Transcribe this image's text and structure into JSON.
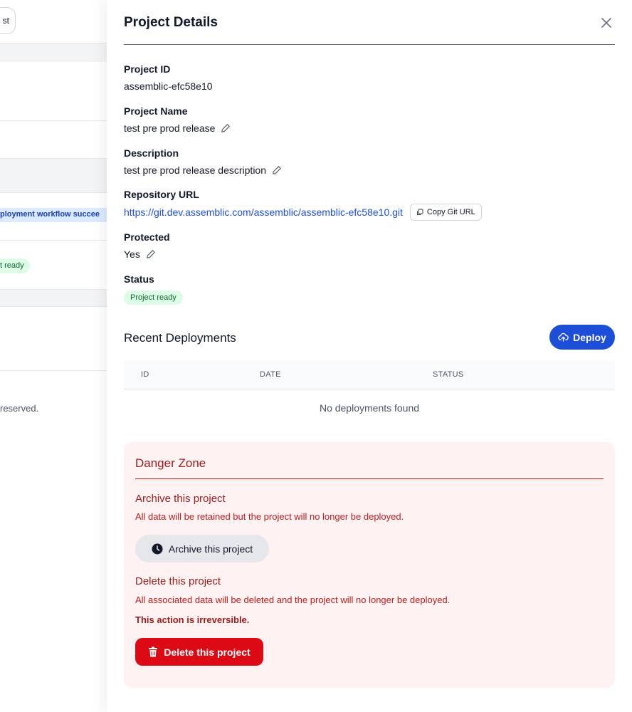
{
  "background": {
    "button_fragment": "st",
    "badge_blue_text": "ployment workflow succee",
    "badge_green_text": "t ready",
    "footer_text": " reserved."
  },
  "drawer": {
    "title": "Project Details",
    "fields": {
      "project_id": {
        "label": "Project ID",
        "value": "assemblic-efc58e10"
      },
      "project_name": {
        "label": "Project Name",
        "value": "test pre prod release"
      },
      "description": {
        "label": "Description",
        "value": "test pre prod release description"
      },
      "repository_url": {
        "label": "Repository URL",
        "value": "https://git.dev.assemblic.com/assemblic/assemblic-efc58e10.git",
        "copy_label": "Copy Git URL"
      },
      "protected": {
        "label": "Protected",
        "value": "Yes"
      },
      "status": {
        "label": "Status",
        "value": "Project ready"
      }
    },
    "deployments": {
      "title": "Recent Deployments",
      "deploy_label": "Deploy",
      "columns": [
        "ID",
        "DATE",
        "STATUS"
      ],
      "empty_text": "No deployments found"
    },
    "danger_zone": {
      "title": "Danger Zone",
      "archive_title": "Archive this project",
      "archive_text": "All data will be retained but the project will no longer be deployed.",
      "archive_button": "Archive this project",
      "delete_title": "Delete this project",
      "delete_text": "All associated data will be deleted and the project will no longer be deployed.",
      "delete_warning": "This action is irreversible.",
      "delete_button": "Delete this project"
    }
  },
  "colors": {
    "primary": "#1d4ed8",
    "danger": "#dc0a14",
    "danger_bg": "#fef2f2",
    "success_bg": "#dcfce7",
    "success_text": "#166534"
  },
  "icons": [
    "close-icon",
    "pencil-icon",
    "copy-icon",
    "upload-cloud-icon",
    "clock-icon",
    "trash-icon"
  ]
}
